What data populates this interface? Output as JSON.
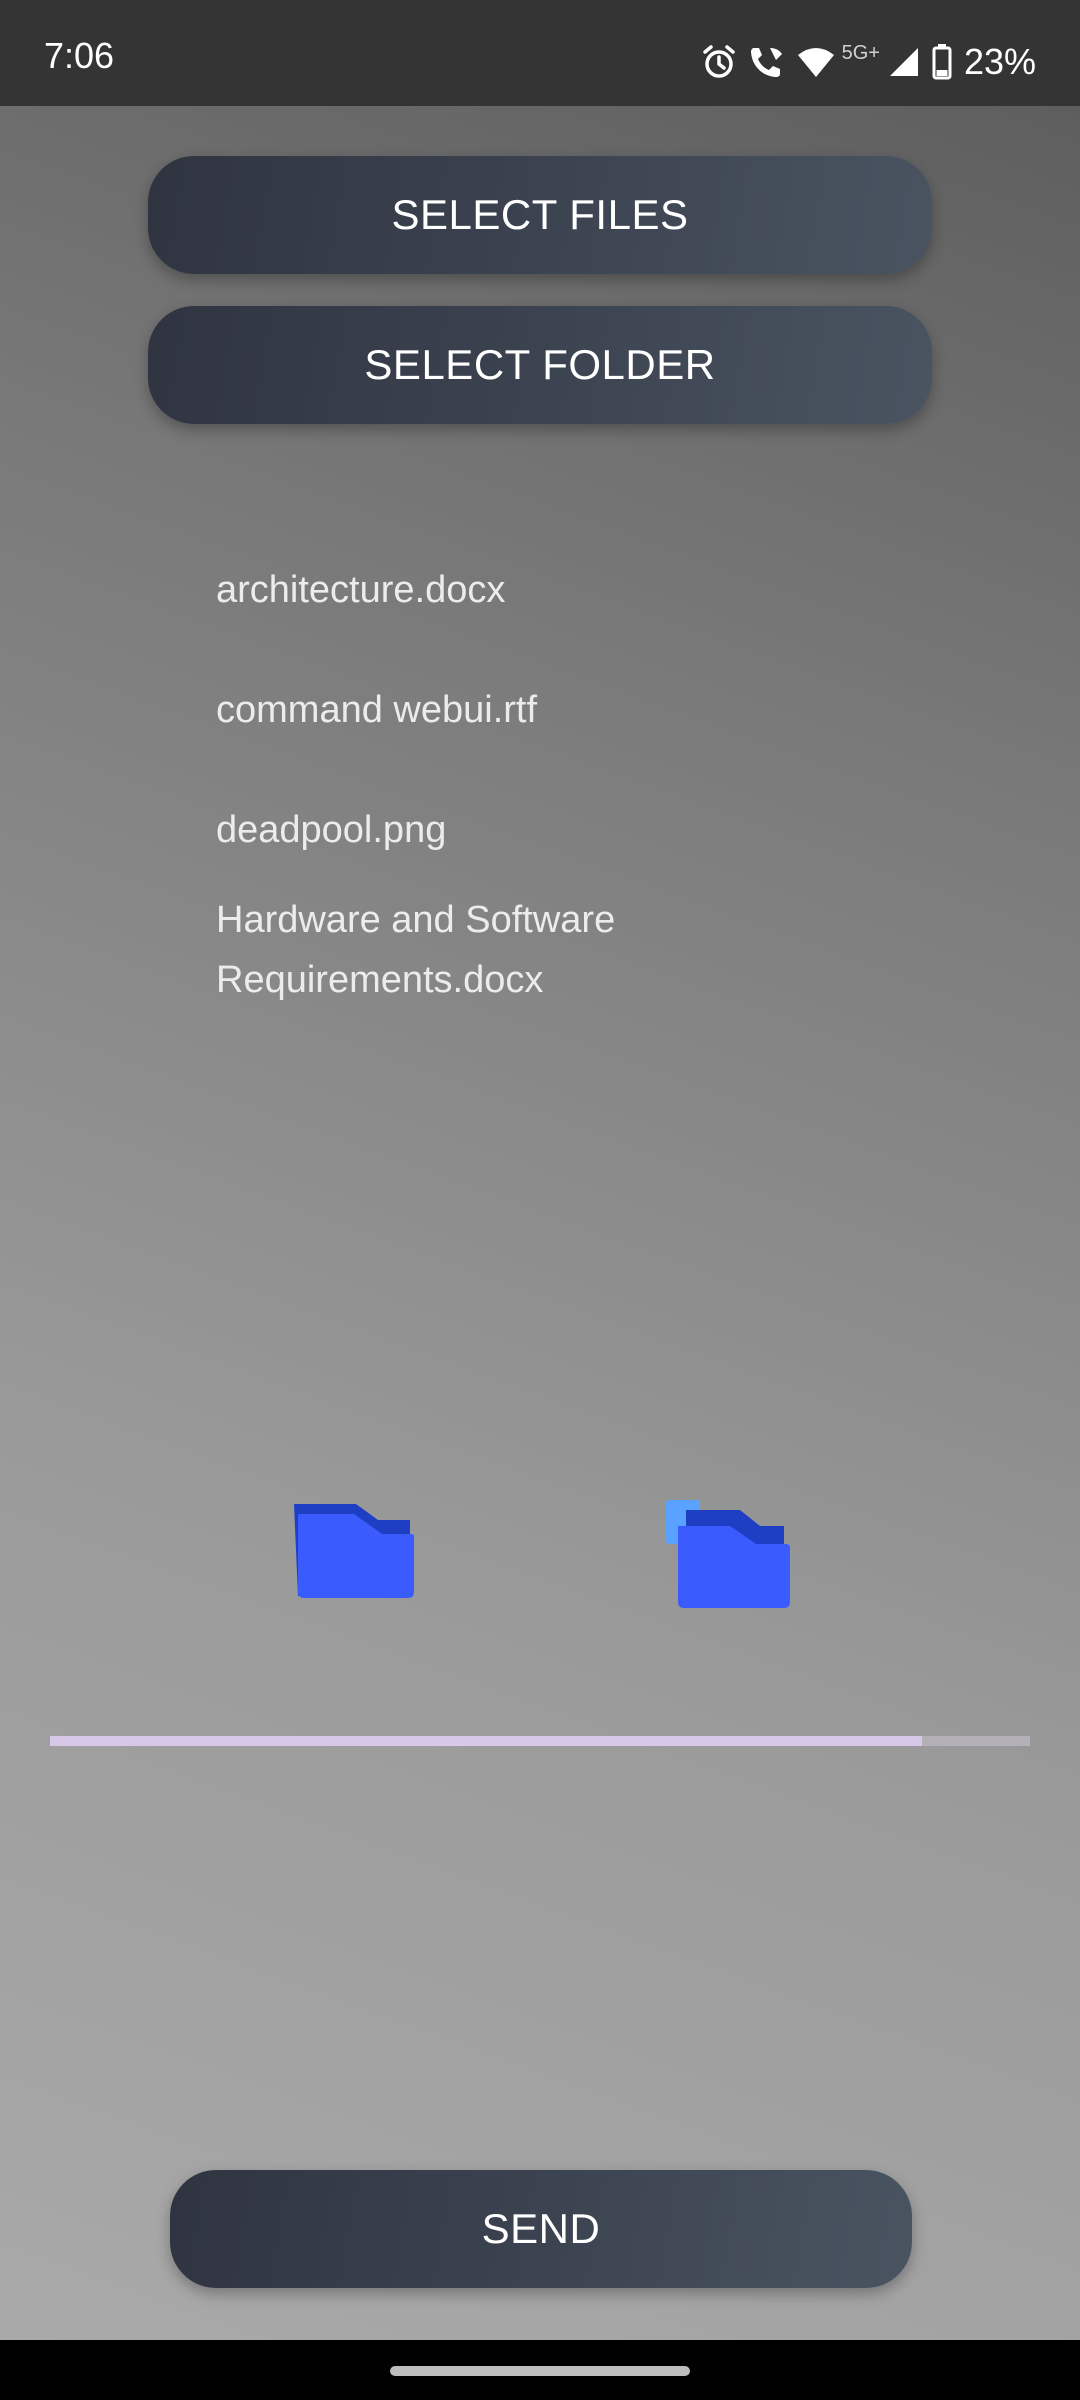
{
  "status_bar": {
    "time": "7:06",
    "network_type": "5G+",
    "battery": "23%",
    "icons": [
      "alarm-icon",
      "wifi-calling-icon",
      "wifi-icon",
      "cellular-signal-icon",
      "battery-icon"
    ]
  },
  "buttons": {
    "select_files": "SELECT FILES",
    "select_folder": "SELECT FOLDER",
    "send": "SEND"
  },
  "files": [
    "architecture.docx",
    "command webui.rtf",
    "deadpool.png",
    "Hardware and Software Requirements.docx"
  ],
  "icons": {
    "left": "folder-icon",
    "right": "folders-icon"
  },
  "progress": {
    "fraction": 0.89
  },
  "colors": {
    "button_dark": "#2f3440",
    "button_light": "#4a5461",
    "folder_blue": "#3a5cff",
    "folder_dark": "#1e3fc4",
    "progress_fill": "#d6c8e6",
    "progress_track": "#b3b0b8"
  }
}
